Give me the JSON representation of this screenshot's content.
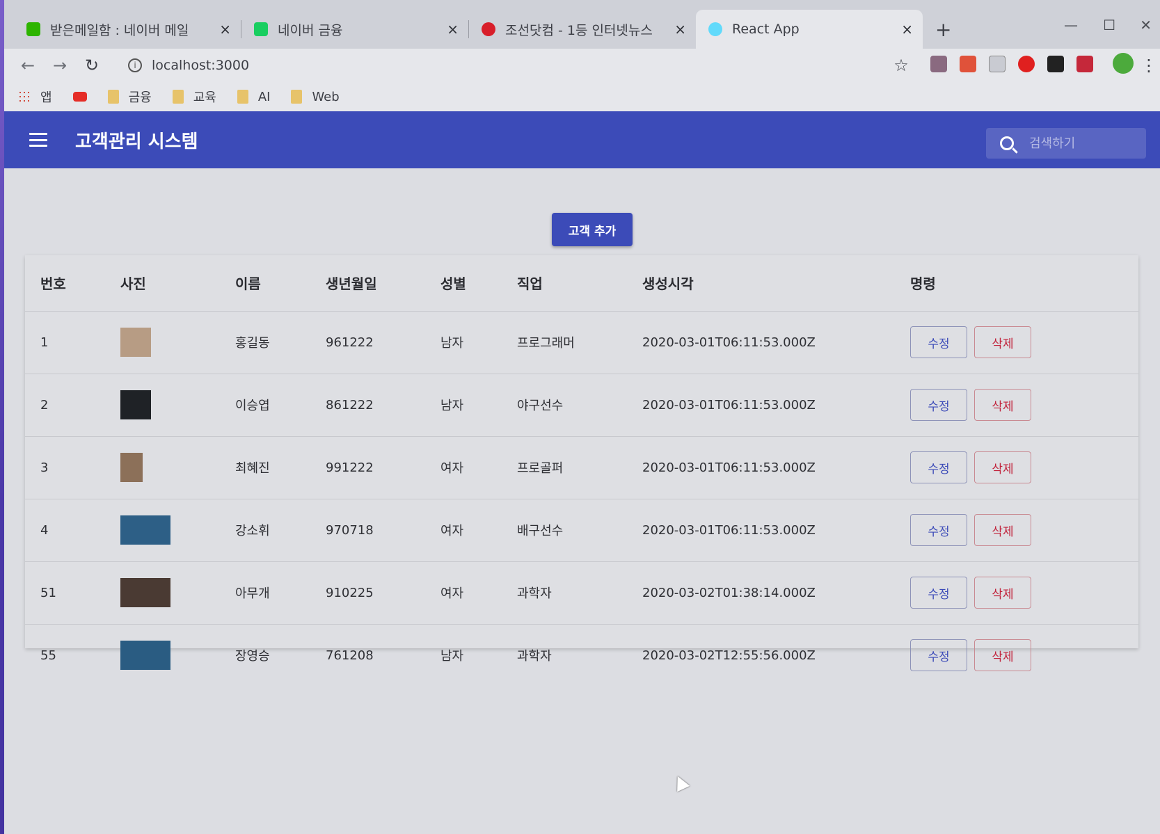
{
  "browser": {
    "tabs": [
      {
        "title": "받은메일함 : 네이버 메일",
        "color": "#2db400"
      },
      {
        "title": "네이버 금융",
        "color": "#19ce60"
      },
      {
        "title": "조선닷컴 - 1등 인터넷뉴스",
        "color": "#d81e2a"
      },
      {
        "title": "React App",
        "color": "#61dafb",
        "active": true
      }
    ],
    "close_glyph": "×",
    "new_tab_glyph": "+",
    "url": "localhost:3000",
    "bookmarks": [
      {
        "label": "앱",
        "icon": "apps-icon"
      },
      {
        "label": "",
        "icon": "youtube-icon"
      },
      {
        "label": "금융",
        "icon": "folder-icon"
      },
      {
        "label": "교육",
        "icon": "folder-icon"
      },
      {
        "label": "AI",
        "icon": "folder-icon"
      },
      {
        "label": "Web",
        "icon": "folder-icon"
      }
    ]
  },
  "app": {
    "title": "고객관리 시스템",
    "search_placeholder": "검색하기",
    "add_button": "고객 추가",
    "primary_color": "#3c4bb8",
    "delete_color": "#c1223b"
  },
  "table": {
    "headers": [
      "번호",
      "사진",
      "이름",
      "생년월일",
      "성별",
      "직업",
      "생성시각",
      "명령"
    ],
    "edit_label": "수정",
    "delete_label": "삭제",
    "rows": [
      {
        "id": "1",
        "name": "홍길동",
        "birthday": "961222",
        "gender": "남자",
        "job": "프로그래머",
        "created": "2020-03-01T06:11:53.000Z",
        "photo_color": "#b79c84"
      },
      {
        "id": "2",
        "name": "이승엽",
        "birthday": "861222",
        "gender": "남자",
        "job": "야구선수",
        "created": "2020-03-01T06:11:53.000Z",
        "photo_color": "#1f2226"
      },
      {
        "id": "3",
        "name": "최혜진",
        "birthday": "991222",
        "gender": "여자",
        "job": "프로골퍼",
        "created": "2020-03-01T06:11:53.000Z",
        "photo_color": "#8c7059"
      },
      {
        "id": "4",
        "name": "강소휘",
        "birthday": "970718",
        "gender": "여자",
        "job": "배구선수",
        "created": "2020-03-01T06:11:53.000Z",
        "photo_color": "#2d5f86"
      },
      {
        "id": "51",
        "name": "아무개",
        "birthday": "910225",
        "gender": "여자",
        "job": "과학자",
        "created": "2020-03-02T01:38:14.000Z",
        "photo_color": "#4a3a33"
      },
      {
        "id": "55",
        "name": "장영승",
        "birthday": "761208",
        "gender": "남자",
        "job": "과학자",
        "created": "2020-03-02T12:55:56.000Z",
        "photo_color": "#2a5c82"
      }
    ]
  }
}
